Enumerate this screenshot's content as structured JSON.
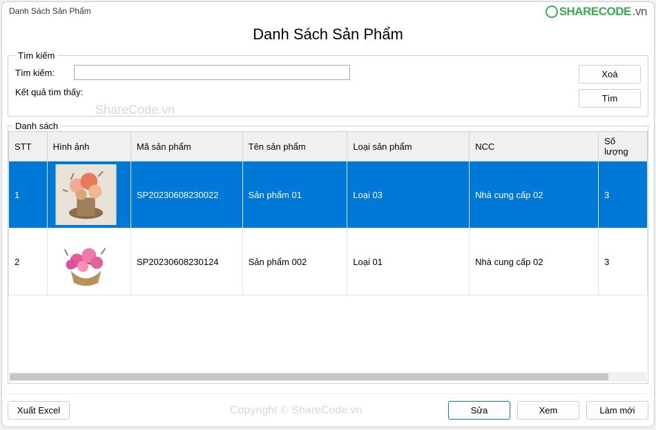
{
  "window_title": "Danh Sách Sản Phẩm",
  "page_heading": "Danh Sách Sản Phẩm",
  "logo": {
    "text": "SHARECODE",
    "suffix": ".vn"
  },
  "watermarks": {
    "wm1": "ShareCode.vn",
    "wm2": "Copyright © ShareCode.vn"
  },
  "search": {
    "legend": "Tìm kiếm",
    "label": "Tìm kiếm:",
    "value": "",
    "result_label": "Kết quả tìm thấy:",
    "delete_btn": "Xoá",
    "find_btn": "Tìm"
  },
  "list": {
    "legend": "Danh sách",
    "columns": {
      "stt": "STT",
      "hinh_anh": "Hình ảnh",
      "ma_sp": "Mã sản phẩm",
      "ten_sp": "Tên sản phẩm",
      "loai_sp": "Loại sản phẩm",
      "ncc": "NCC",
      "so_luong": "Số lượng"
    },
    "rows": [
      {
        "stt": "1",
        "ma": "SP20230608230022",
        "ten": "Sản phẩm 01",
        "loai": "Loại 03",
        "ncc": "Nhà cung cấp 02",
        "sl": "3",
        "selected": true,
        "img": "flower-vase"
      },
      {
        "stt": "2",
        "ma": "SP20230608230124",
        "ten": "Sản phẩm 002",
        "loai": "Loại 01",
        "ncc": "Nhà cung cấp 02",
        "sl": "3",
        "selected": false,
        "img": "flower-basket"
      }
    ]
  },
  "buttons": {
    "export": "Xuất Excel",
    "edit": "Sửa",
    "view": "Xem",
    "refresh": "Làm mới"
  }
}
